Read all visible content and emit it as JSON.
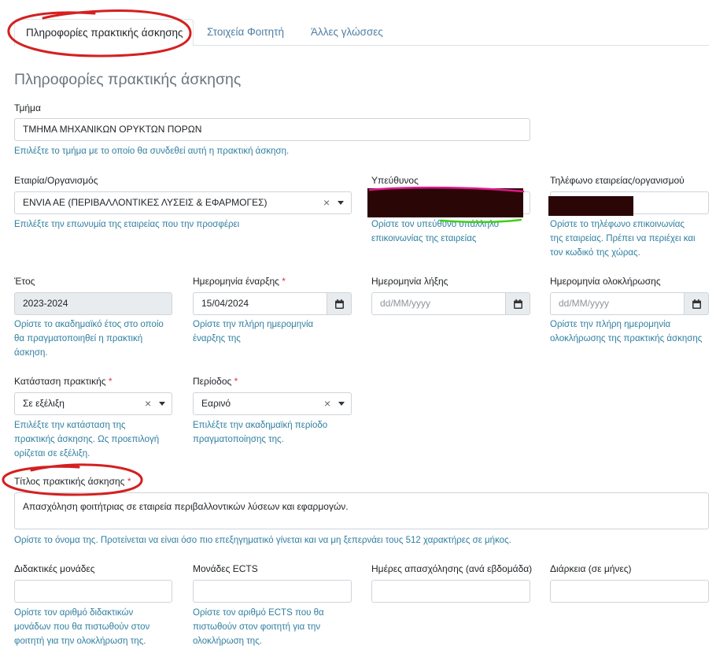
{
  "tabs": [
    {
      "label": "Πληροφορίες πρακτικής άσκησης"
    },
    {
      "label": "Στοιχεία Φοιτητή"
    },
    {
      "label": "Άλλες γλώσσες"
    }
  ],
  "page_title": "Πληροφορίες πρακτικής άσκησης",
  "department": {
    "label": "Τμήμα",
    "value": "ΤΜΗΜΑ ΜΗΧΑΝΙΚΩΝ ΟΡΥΚΤΩΝ ΠΟΡΩΝ",
    "help": "Επιλέξτε το τμήμα με το οποίο θα συνδεθεί αυτή η πρακτική άσκηση."
  },
  "company": {
    "label": "Εταιρία/Οργανισμός",
    "value": "ENVIA AE (ΠΕΡΙΒΑΛΛΟΝΤΙΚΕΣ ΛΥΣΕΙΣ & ΕΦΑΡΜΟΓΕΣ)",
    "help": "Επιλέξτε την επωνυμία της εταιρείας που την προσφέρει"
  },
  "supervisor": {
    "label": "Υπεύθυνος",
    "help_line1": "Ορίστε τον υπεύθυνο υπάλληλο",
    "help_line2": "επικοινωνίας της εταιρείας"
  },
  "phone": {
    "label": "Τηλέφωνο εταιρείας/οργανισμού",
    "help_line1": "Ορίστε το τηλέφωνο επικοινωνίας",
    "help_line2": "της εταιρείας. Πρέπει να περιέχει και",
    "help_line3": "τον κωδικό της χώρας."
  },
  "year": {
    "label": "Έτος",
    "value": "2023-2024",
    "help_line1": "Ορίστε το ακαδημαϊκό έτος στο οποίο",
    "help_line2": "θα πραγματοποιηθεί η πρακτική",
    "help_line3": "άσκηση."
  },
  "start_date": {
    "label": "Ημερομηνία έναρξης",
    "required": "*",
    "value": "15/04/2024",
    "help_line1": "Ορίστε την πλήρη ημερομηνία",
    "help_line2": "έναρξης της"
  },
  "end_date": {
    "label": "Ημερομηνία λήξης",
    "placeholder": "dd/MM/yyyy"
  },
  "completion_date": {
    "label": "Ημερομηνία ολοκλήρωσης",
    "placeholder": "dd/MM/yyyy",
    "help_line1": "Ορίστε την πλήρη ημερομηνία",
    "help_line2": "ολοκλήρωσης της πρακτικής άσκησης"
  },
  "status": {
    "label": "Κατάσταση πρακτικής",
    "required": "*",
    "value": "Σε εξέλιξη",
    "help_line1": "Επιλέξτε την κατάσταση της",
    "help_line2": "πρακτικής άσκησης. Ως προεπιλογή",
    "help_line3": "ορίζεται σε εξέλιξη."
  },
  "period": {
    "label": "Περίοδος",
    "required": "*",
    "value": "Εαρινό",
    "help_line1": "Επιλέξτε την ακαδημαϊκή περίοδο",
    "help_line2": "πραγματοποίησης της."
  },
  "internship_title": {
    "label": "Τίτλος πρακτικής άσκησης",
    "required": "*",
    "value": "Απασχόληση φοιτήτριας σε εταιρεία περιβαλλοντικών λύσεων και εφαρμογών.",
    "help": "Ορίστε το όνομα της. Προτείνεται να είναι όσο πιο επεξηγηματικό γίνεται και να μη ξεπερνάει τους 512 χαρακτήρες σε μήκος."
  },
  "teaching_units": {
    "label": "Διδακτικές μονάδες",
    "help_line1": "Ορίστε τον αριθμό διδακτικών",
    "help_line2": "μονάδων που θα πιστωθούν στον",
    "help_line3": "φοιτητή για την ολοκλήρωση της."
  },
  "ects": {
    "label": "Μονάδες ECTS",
    "help_line1": "Ορίστε τον αριθμό ECTS που θα",
    "help_line2": "πιστωθούν στον φοιτητή για την",
    "help_line3": "ολοκλήρωση της."
  },
  "work_days": {
    "label": "Ημέρες απασχόλησης (ανά εβδομάδα)"
  },
  "duration": {
    "label": "Διάρκεια (σε μήνες)"
  },
  "colors": {
    "accent_text": "#2f7fa0",
    "tab_text": "#4f7da3",
    "required": "#dc3545",
    "annotation": "#d42020"
  }
}
